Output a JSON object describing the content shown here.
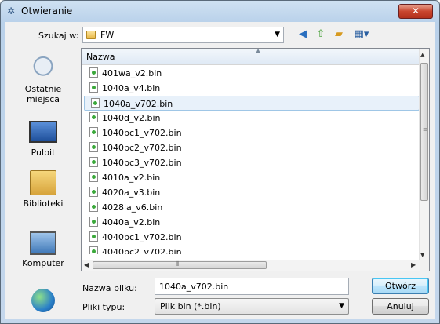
{
  "window": {
    "title": "Otwieranie"
  },
  "lookin": {
    "label": "Szukaj w:",
    "value": "FW"
  },
  "places": [
    {
      "label": "Ostatnie miejsca",
      "icon": "recent-places-icon"
    },
    {
      "label": "Pulpit",
      "icon": "desktop-icon"
    },
    {
      "label": "Biblioteki",
      "icon": "libraries-icon"
    },
    {
      "label": "Komputer",
      "icon": "computer-icon"
    },
    {
      "label": "",
      "icon": "network-icon"
    }
  ],
  "filelist": {
    "column_header": "Nazwa",
    "files": [
      "401wa_v2.bin",
      "1040a_v4.bin",
      "1040a_v702.bin",
      "1040d_v2.bin",
      "1040pc1_v702.bin",
      "1040pc2_v702.bin",
      "1040pc3_v702.bin",
      "4010a_v2.bin",
      "4020a_v3.bin",
      "4028la_v6.bin",
      "4040a_v2.bin",
      "4040pc1_v702.bin",
      "4040pc2_v702.bin"
    ],
    "selected_index": 2
  },
  "filename": {
    "label": "Nazwa pliku:",
    "value": "1040a_v702.bin"
  },
  "filetype": {
    "label": "Pliki typu:",
    "value": "Plik bin (*.bin)"
  },
  "buttons": {
    "open": "Otwórz",
    "cancel": "Anuluj"
  },
  "colors": {
    "selection": "#e8f1fa",
    "close_button": "#c9452e",
    "default_button": "#bee6fd"
  }
}
